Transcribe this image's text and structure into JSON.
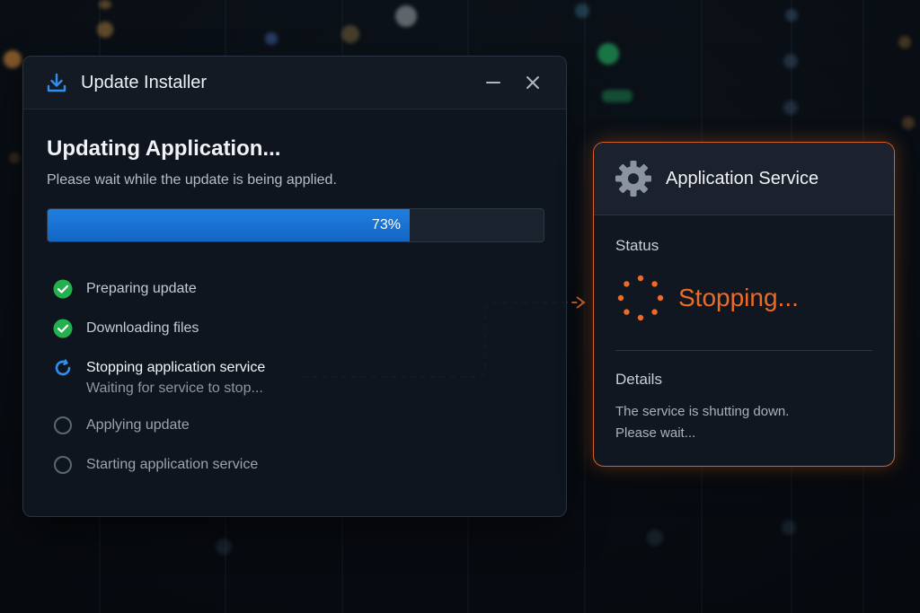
{
  "window": {
    "title": "Update Installer",
    "icon": "download-icon",
    "minimize_icon": "minimize-icon",
    "close_icon": "close-icon"
  },
  "installer": {
    "heading": "Updating Application...",
    "subheading": "Please wait while the update is being applied.",
    "progress": {
      "percent": 73,
      "label": "73%"
    },
    "steps": [
      {
        "label": "Preparing update",
        "status": "done",
        "icon": "check-circle-icon"
      },
      {
        "label": "Downloading files",
        "status": "done",
        "icon": "check-circle-icon"
      },
      {
        "label": "Stopping application service",
        "sublabel": "Waiting for service to stop...",
        "status": "active",
        "icon": "refresh-spinner-icon"
      },
      {
        "label": "Applying update",
        "status": "pending",
        "icon": "empty-circle-icon"
      },
      {
        "label": "Starting application service",
        "status": "pending",
        "icon": "empty-circle-icon"
      }
    ]
  },
  "service": {
    "title": "Application Service",
    "icon": "gear-icon",
    "status_label": "Status",
    "status_value": "Stopping...",
    "details_label": "Details",
    "details_line1": "The service is shutting down.",
    "details_line2": "Please wait..."
  },
  "colors": {
    "accent_blue": "#1f7fe0",
    "success_green": "#22b14c",
    "warning_orange": "#ef6a25",
    "panel_bg": "#10161f",
    "border": "#2a3442"
  }
}
